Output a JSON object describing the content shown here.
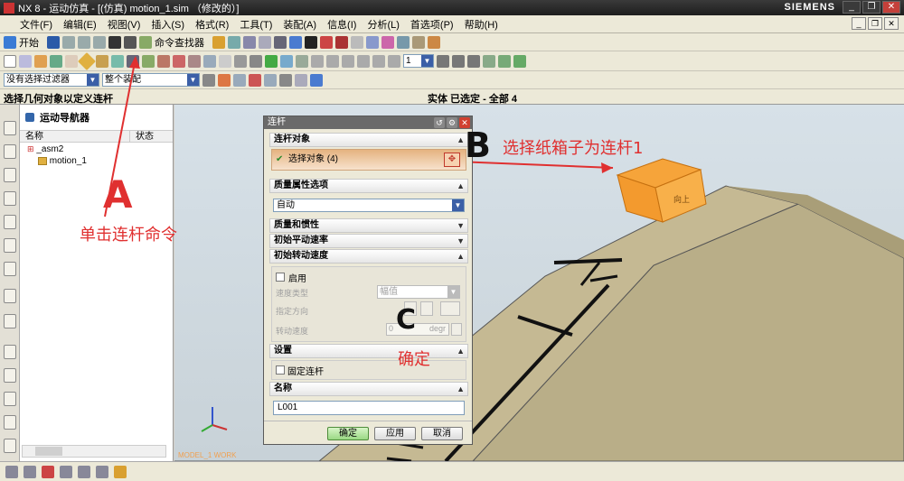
{
  "window": {
    "title": "NX 8 - 运动仿真 - [(仿真) motion_1.sim （修改的）]",
    "brand": "SIEMENS",
    "controls": [
      "_",
      "❐",
      "✕"
    ]
  },
  "menu": [
    "文件(F)",
    "编辑(E)",
    "视图(V)",
    "插入(S)",
    "格式(R)",
    "工具(T)",
    "装配(A)",
    "信息(I)",
    "分析(L)",
    "首选项(P)",
    "帮助(H)"
  ],
  "toolbar": {
    "start_label": "开始",
    "command_finder_label": "命令查找器",
    "filter_value": "没有选择过滤器",
    "scope_value": "整个装配",
    "spin_value": "1"
  },
  "status": {
    "prompt": "选择几何对象以定义连杆",
    "selection": "实体 已选定 - 全部 4"
  },
  "navigator": {
    "title": "运动导航器",
    "col_name": "名称",
    "col_status": "状态",
    "items": [
      "_asm2",
      "motion_1"
    ]
  },
  "viewport": {
    "wcs_label": "MODEL_1 WORK",
    "box_text": "向上"
  },
  "dialog": {
    "title": "连杆",
    "sections": {
      "link_object": "连杆对象",
      "mass_options": "质量属性选项",
      "mass_inertia": "质量和惯性",
      "init_translate": "初始平动速率",
      "init_rotate": "初始转动速度",
      "settings": "设置",
      "name": "名称"
    },
    "select_object": "选择对象 (4)",
    "mass_option_value": "自动",
    "enable_label": "启用",
    "speed_type_label": "速度类型",
    "speed_type_value": "幅值",
    "direction_label": "指定方向",
    "rot_speed_label": "转动速度",
    "rot_speed_value": "0",
    "rot_speed_unit": "degr",
    "fixed_link_label": "固定连杆",
    "name_value": "L001",
    "ok_label": "确定",
    "apply_label": "应用",
    "cancel_label": "取消"
  },
  "annotations": {
    "a_letter": "A",
    "a_text": "单击连杆命令",
    "b_letter": "B",
    "b_text": "选择纸箱子为连杆1",
    "c_letter": "C",
    "c_text": "确定"
  },
  "colors": {
    "annotation": "#e03030",
    "ground_top": "#b8ac86",
    "ground_side": "#a89b72",
    "box": "#f39a2e"
  }
}
